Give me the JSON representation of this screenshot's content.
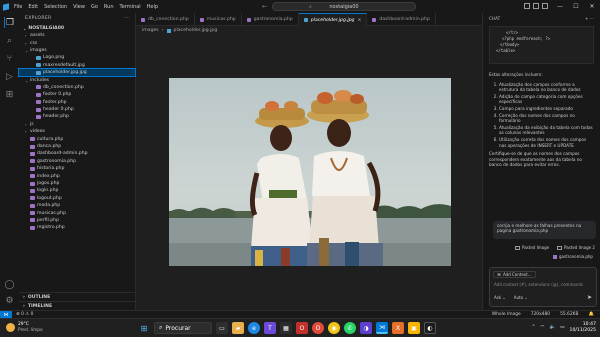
{
  "titlebar": {
    "menu": [
      "File",
      "Edit",
      "Selection",
      "View",
      "Go",
      "Run",
      "Terminal",
      "Help"
    ],
    "search_text": "nostalgia00"
  },
  "explorer": {
    "header": "EXPLORER",
    "project": "NOSTALGIA00",
    "tree": [
      {
        "label": "assets",
        "type": "folder",
        "open": false,
        "indent": 1
      },
      {
        "label": "css",
        "type": "folder",
        "open": false,
        "indent": 1
      },
      {
        "label": "images",
        "type": "folder",
        "open": true,
        "indent": 1
      },
      {
        "label": "Logo.png",
        "type": "image",
        "indent": 2
      },
      {
        "label": "maxresdefault.jpg",
        "type": "image",
        "indent": 2
      },
      {
        "label": "placeholder.jpg.jpg",
        "type": "image",
        "indent": 2,
        "selected": true
      },
      {
        "label": "includes",
        "type": "folder",
        "open": true,
        "indent": 1
      },
      {
        "label": "db_conection.php",
        "type": "php",
        "indent": 2
      },
      {
        "label": "footer 0.php",
        "type": "php",
        "indent": 2
      },
      {
        "label": "footer.php",
        "type": "php",
        "indent": 2
      },
      {
        "label": "header 0.php",
        "type": "php",
        "indent": 2
      },
      {
        "label": "header.php",
        "type": "php",
        "indent": 2
      },
      {
        "label": "js",
        "type": "folder",
        "open": false,
        "indent": 1
      },
      {
        "label": "videos",
        "type": "folder",
        "open": false,
        "indent": 1
      },
      {
        "label": "cultura.php",
        "type": "php",
        "indent": 1
      },
      {
        "label": "danca.php",
        "type": "php",
        "indent": 1
      },
      {
        "label": "dashboard-admin.php",
        "type": "php",
        "indent": 1
      },
      {
        "label": "gastronomia.php",
        "type": "php",
        "indent": 1
      },
      {
        "label": "historia.php",
        "type": "php",
        "indent": 1
      },
      {
        "label": "index.php",
        "type": "php",
        "indent": 1
      },
      {
        "label": "jogos.php",
        "type": "php",
        "indent": 1
      },
      {
        "label": "login.php",
        "type": "php",
        "indent": 1
      },
      {
        "label": "logout.php",
        "type": "php",
        "indent": 1
      },
      {
        "label": "moda.php",
        "type": "php",
        "indent": 1
      },
      {
        "label": "musicas.php",
        "type": "php",
        "indent": 1
      },
      {
        "label": "perfil.php",
        "type": "php",
        "indent": 1
      },
      {
        "label": "registro.php",
        "type": "php",
        "indent": 1
      }
    ],
    "outline": "OUTLINE",
    "timeline": "TIMELINE"
  },
  "tabs": [
    {
      "label": "db_conection.php",
      "active": false
    },
    {
      "label": "musicas.php",
      "active": false
    },
    {
      "label": "gastronomia.php",
      "active": false
    },
    {
      "label": "placeholder.jpg.jpg",
      "active": true
    },
    {
      "label": "dashboard-admin.php",
      "active": false
    }
  ],
  "breadcrumb": [
    "images",
    "placeholder.jpg.jpg"
  ],
  "chat": {
    "header": "CHAT",
    "code_lines": [
      "</tr>",
      "<?php endforeach; ?>",
      "</tbody>",
      "</table>"
    ],
    "intro": "Estas alterações incluem:",
    "items": [
      "Atualização dos campos conforme a estrutura da tabela no banco de dados",
      "Adição do campo categoria com opções específicas",
      "Campo para ingredientes separado",
      "Correção dos nomes dos campos no formulário",
      "Atualização da exibição da tabela com todas as colunas relevantes",
      "Utilização correta dos nomes dos campos nas operações de INSERT e UPDATE"
    ],
    "closing": "Certifique-se de que os nomes dos campos correspondem exatamente aos da tabela no banco de dados para evitar erros.",
    "user_message": "corrija e melhore as falhas presentes na pagina gastronomia.php",
    "pasted1": "Pasted Image",
    "pasted2": "Pasted Image 2",
    "context_file": "gastronomia.php",
    "add_context": "Add Context...",
    "placeholder": "Add context (#), extensions (@), commands",
    "mode": "Ask",
    "model": "Auto"
  },
  "statusbar": {
    "errors": "0",
    "warnings": "0",
    "right": [
      "Whole Image",
      "720x480",
      "55.62KB"
    ]
  },
  "taskbar": {
    "temperature": "29°C",
    "weather": "Pred. limpo",
    "search": "Procurar",
    "time": "10:47",
    "date": "10/11/2025"
  }
}
